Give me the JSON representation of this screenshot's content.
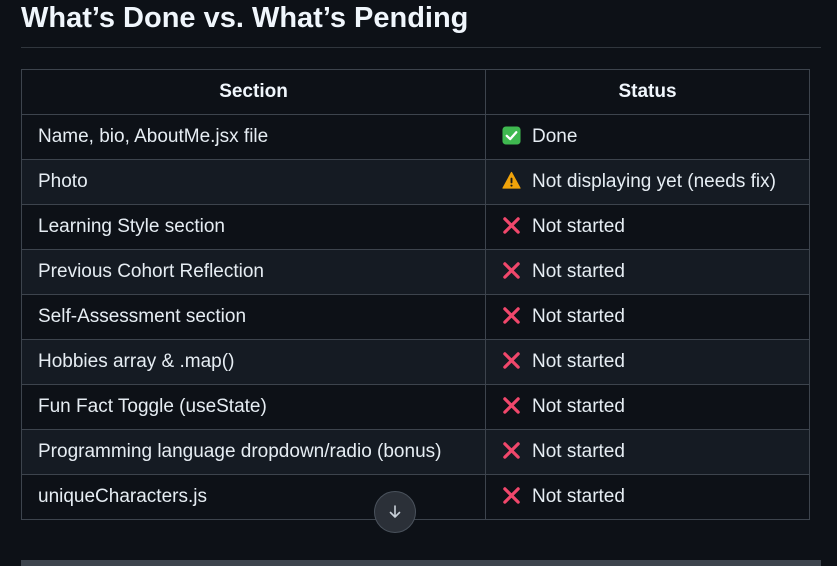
{
  "heading": "What’s Done vs. What’s Pending",
  "table": {
    "headers": {
      "section": "Section",
      "status": "Status"
    },
    "rows": [
      {
        "section": "Name, bio, AboutMe.jsx file",
        "status": "Done",
        "icon": "check-mark-icon"
      },
      {
        "section": "Photo",
        "status": "Not displaying yet (needs fix)",
        "icon": "warning-icon"
      },
      {
        "section": "Learning Style section",
        "status": "Not started",
        "icon": "cross-mark-icon"
      },
      {
        "section": "Previous Cohort Reflection",
        "status": "Not started",
        "icon": "cross-mark-icon"
      },
      {
        "section": "Self-Assessment section",
        "status": "Not started",
        "icon": "cross-mark-icon"
      },
      {
        "section": "Hobbies array & .map()",
        "status": "Not started",
        "icon": "cross-mark-icon"
      },
      {
        "section": "Fun Fact Toggle (useState)",
        "status": "Not started",
        "icon": "cross-mark-icon"
      },
      {
        "section": "Programming language dropdown/radio (bonus)",
        "status": "Not started",
        "icon": "cross-mark-icon"
      },
      {
        "section": "uniqueCharacters.js",
        "status": "Not started",
        "icon": "cross-mark-icon"
      }
    ]
  },
  "scroll_button": {
    "icon": "arrow-down-icon"
  },
  "colors": {
    "background": "#0d1117",
    "row_alt": "#151b23",
    "border": "#3d444d",
    "done": "#3fb950",
    "warning": "#f0a30a",
    "cross": "#f0476b"
  }
}
